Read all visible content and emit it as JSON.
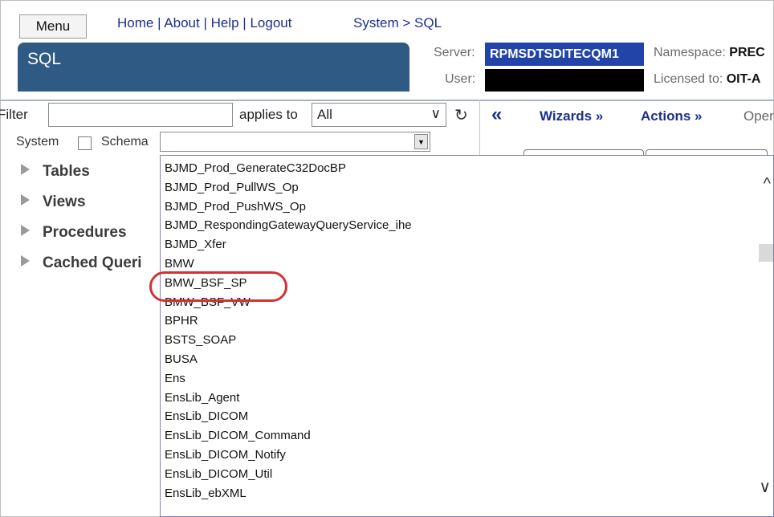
{
  "header": {
    "menu_label": "Menu",
    "nav": [
      "Home",
      "About",
      "Help",
      "Logout"
    ],
    "breadcrumb": "System > SQL",
    "page_title": "SQL",
    "server_label": "Server:",
    "server_value": "RPMSDTSDITECQM1",
    "user_label": "User:",
    "namespace_label": "Namespace:",
    "namespace_value": "PREC",
    "licensed_label": "Licensed to:",
    "licensed_value": "OIT-A"
  },
  "filter": {
    "label": "Filter",
    "value": "",
    "applies_label": "applies to",
    "applies_value": "All"
  },
  "schema": {
    "system_label": "System",
    "schema_label": "Schema"
  },
  "tree": [
    "Tables",
    "Views",
    "Procedures",
    "Cached Queri"
  ],
  "toolbar": {
    "wizards": "Wizards »",
    "actions": "Actions »",
    "open": "Open"
  },
  "schema_options": [
    "BJMD_Prod_GenerateC32DocBP",
    "BJMD_Prod_PullWS_Op",
    "BJMD_Prod_PushWS_Op",
    "BJMD_RespondingGatewayQueryService_ihe",
    "BJMD_Xfer",
    "BMW",
    "BMW_BSF_SP",
    "BMW_BSF_VW",
    "BPHR",
    "BSTS_SOAP",
    "BUSA",
    "Ens",
    "EnsLib_Agent",
    "EnsLib_DICOM",
    "EnsLib_DICOM_Command",
    "EnsLib_DICOM_Notify",
    "EnsLib_DICOM_Util",
    "EnsLib_ebXML"
  ],
  "colors": {
    "title_bar": "#2e5a83",
    "server_badge": "#2244a8",
    "link": "#1c2f8a",
    "highlight_ring": "#d3302f"
  }
}
